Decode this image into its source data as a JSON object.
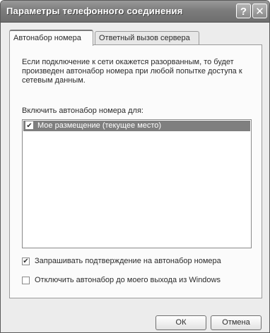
{
  "window": {
    "title": "Параметры телефонного соединения",
    "help_button": "?",
    "close_button": "✕"
  },
  "tabs": [
    {
      "label": "Автонабор номера",
      "active": true
    },
    {
      "label": "Ответный вызов сервера",
      "active": false
    }
  ],
  "autodial": {
    "description": "Если подключение к сети окажется разорванным, то будет произведен автонабор номера при любой попытке доступа к сетевым данным.",
    "list_label": "Включить автонабор номера для:",
    "locations": [
      {
        "label": "Мое размещение (текущее место)",
        "checked": true,
        "selected": true
      }
    ],
    "confirm_option": {
      "label": "Запрашивать подтверждение на автонабор номера",
      "checked": true
    },
    "disable_option": {
      "label": "Отключить автонабор до моего выхода из Windows",
      "checked": false
    }
  },
  "buttons": {
    "ok": "ОК",
    "cancel": "Отмена"
  },
  "colors": {
    "title_bar": "#7c7c7c",
    "selection": "#7f7f7f"
  }
}
